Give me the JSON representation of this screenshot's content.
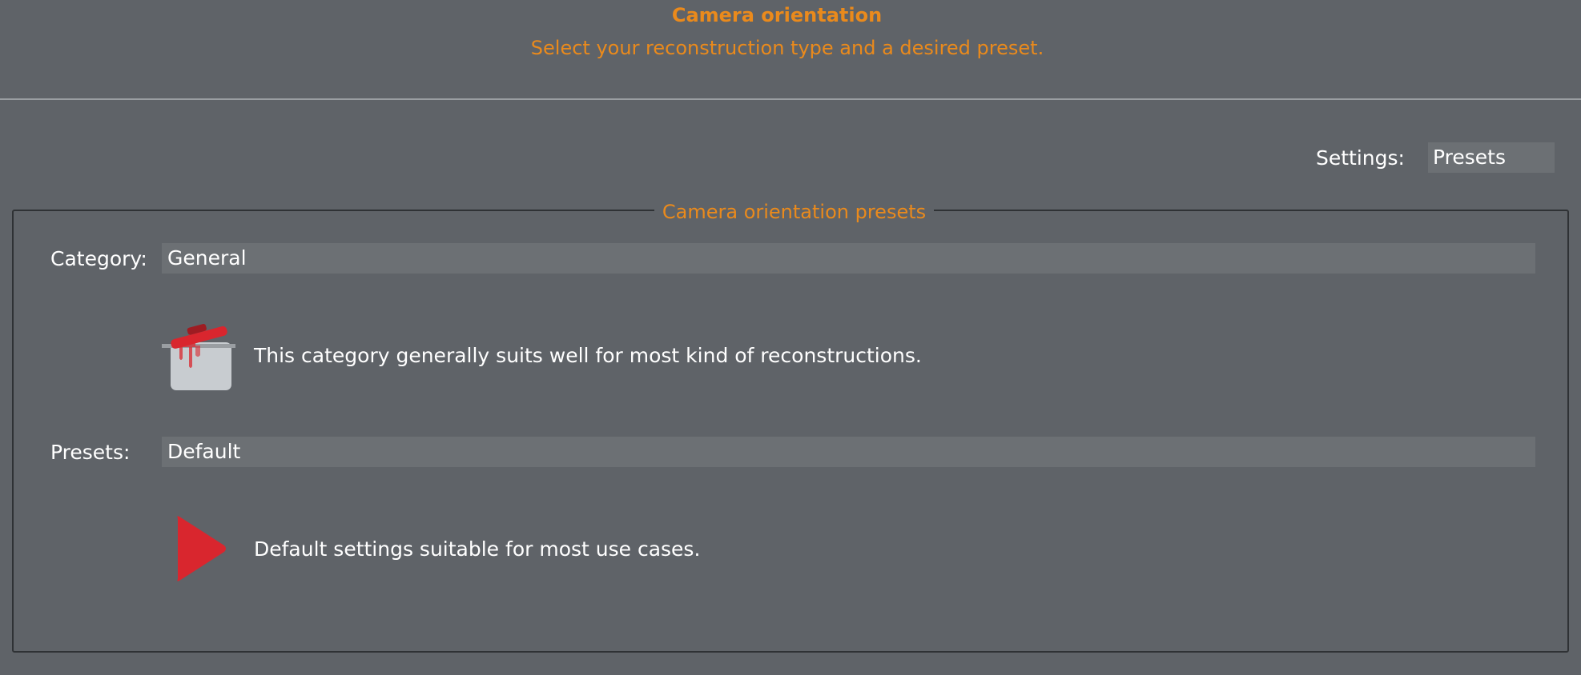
{
  "header": {
    "title": "Camera orientation",
    "subtitle": "Select your reconstruction type and a desired preset."
  },
  "settings": {
    "label": "Settings:",
    "value": "Presets"
  },
  "presets_group": {
    "title": "Camera orientation presets",
    "category": {
      "label": "Category:",
      "value": "General",
      "icon": "cooking-pot-icon",
      "description": "This category generally suits well for most kind of reconstructions."
    },
    "presets": {
      "label": "Presets:",
      "value": "Default",
      "icon": "play-triangle-icon",
      "description": "Default settings suitable for most use cases."
    }
  },
  "colors": {
    "accent": "#ea8a1c",
    "background": "#5f6368",
    "field": "#6c7074",
    "icon_red": "#d9262e"
  }
}
